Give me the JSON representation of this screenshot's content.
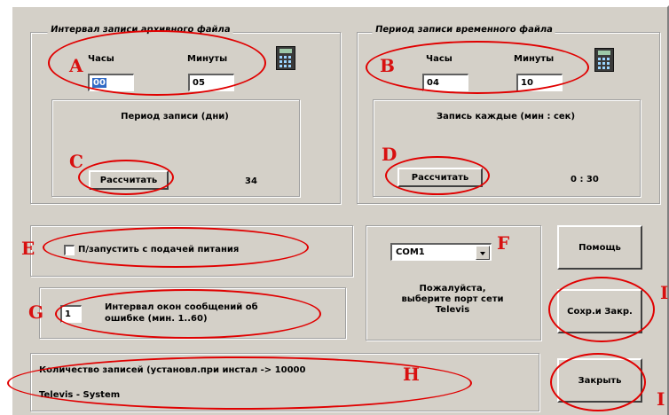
{
  "archive": {
    "legend": "Интервал записи архивного файла",
    "hours_label": "Часы",
    "minutes_label": "Минуты",
    "hours_value": "00",
    "minutes_value": "05",
    "period_title": "Период записи (дни)",
    "calc_button": "Рассчитать",
    "result": "34"
  },
  "temp": {
    "legend": "Период записи временного файла",
    "hours_label": "Часы",
    "minutes_label": "Минуты",
    "hours_value": "04",
    "minutes_value": "10",
    "period_title": "Запись каждые (мин : сек)",
    "calc_button": "Рассчитать",
    "result": "0 : 30"
  },
  "autostart": {
    "label": "П/запустить с подачей питания",
    "checked": false
  },
  "interval": {
    "value": "1",
    "label_line1": "Интервал окон сообщений об",
    "label_line2": "ошибке (мин. 1..60)"
  },
  "records": {
    "text": "Количество записей (установл.при инстал -> 10000",
    "company": "Televis - System"
  },
  "port": {
    "selected": "COM1",
    "hint_line1": "Пожалуйста,",
    "hint_line2": "выберите порт сети",
    "hint_line3": "Televis"
  },
  "buttons": {
    "help": "Помощь",
    "save_close": "Сохр.и Закр.",
    "close": "Закрыть"
  },
  "markers": {
    "A": "A",
    "B": "B",
    "C": "C",
    "D": "D",
    "E": "E",
    "F": "F",
    "G": "G",
    "H": "H",
    "I": "I"
  },
  "colors": {
    "dialog_bg": "#d4d0c8",
    "annotation": "#e00000"
  }
}
